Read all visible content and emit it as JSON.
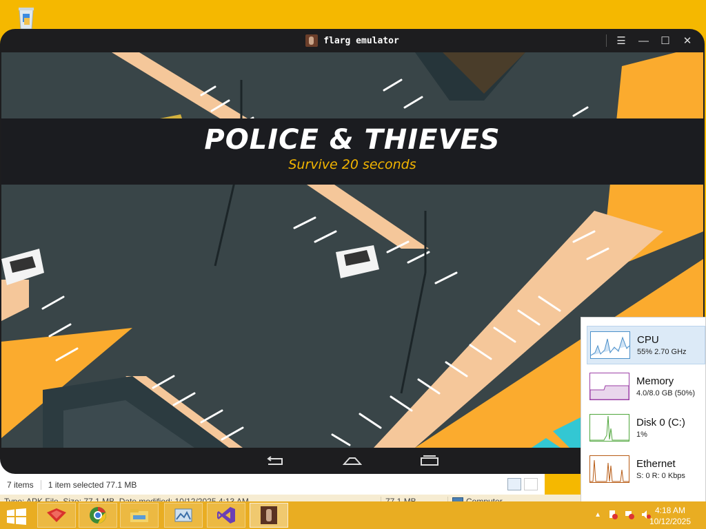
{
  "desktop": {
    "icons": [
      {
        "name": "recycle-bin-icon"
      }
    ]
  },
  "emulator": {
    "title": "flarg emulator",
    "controls": [
      "menu",
      "minimize",
      "maximize",
      "close"
    ],
    "game": {
      "title": "POLICE & THIEVES",
      "subtitle": "Survive 20 seconds",
      "colors": {
        "asphalt": "#394548",
        "accent": "#f2b400",
        "curb": "#f5c79a",
        "orange": "#fbab2e"
      }
    },
    "nav": [
      "back",
      "home",
      "recents"
    ]
  },
  "explorer": {
    "status_items": "7 items",
    "status_selected": "1 item selected  77.1 MB",
    "details_info": "Type: APK File, Size: 77.1 MB, Date modified: 10/12/2025 4:13 AM",
    "details_size": "77.1 MB",
    "details_location": "Computer"
  },
  "performance": {
    "items": [
      {
        "name": "CPU",
        "value": "55% 2.70 GHz",
        "color": "#4a8fc9",
        "selected": true
      },
      {
        "name": "Memory",
        "value": "4.0/8.0 GB (50%)",
        "color": "#9b3fa6",
        "selected": false
      },
      {
        "name": "Disk 0 (C:)",
        "value": "1%",
        "color": "#4ea53a",
        "selected": false
      },
      {
        "name": "Ethernet",
        "value": "S: 0  R: 0 Kbps",
        "color": "#b75a13",
        "selected": false
      }
    ]
  },
  "taskbar": {
    "apps": [
      "gem-app-icon",
      "chrome-icon",
      "file-explorer-icon",
      "image-app-icon",
      "visual-studio-icon",
      "flarg-emulator-icon"
    ],
    "active": "flarg-emulator-icon",
    "time": "4:18 AM",
    "date": "10/12/2025"
  }
}
